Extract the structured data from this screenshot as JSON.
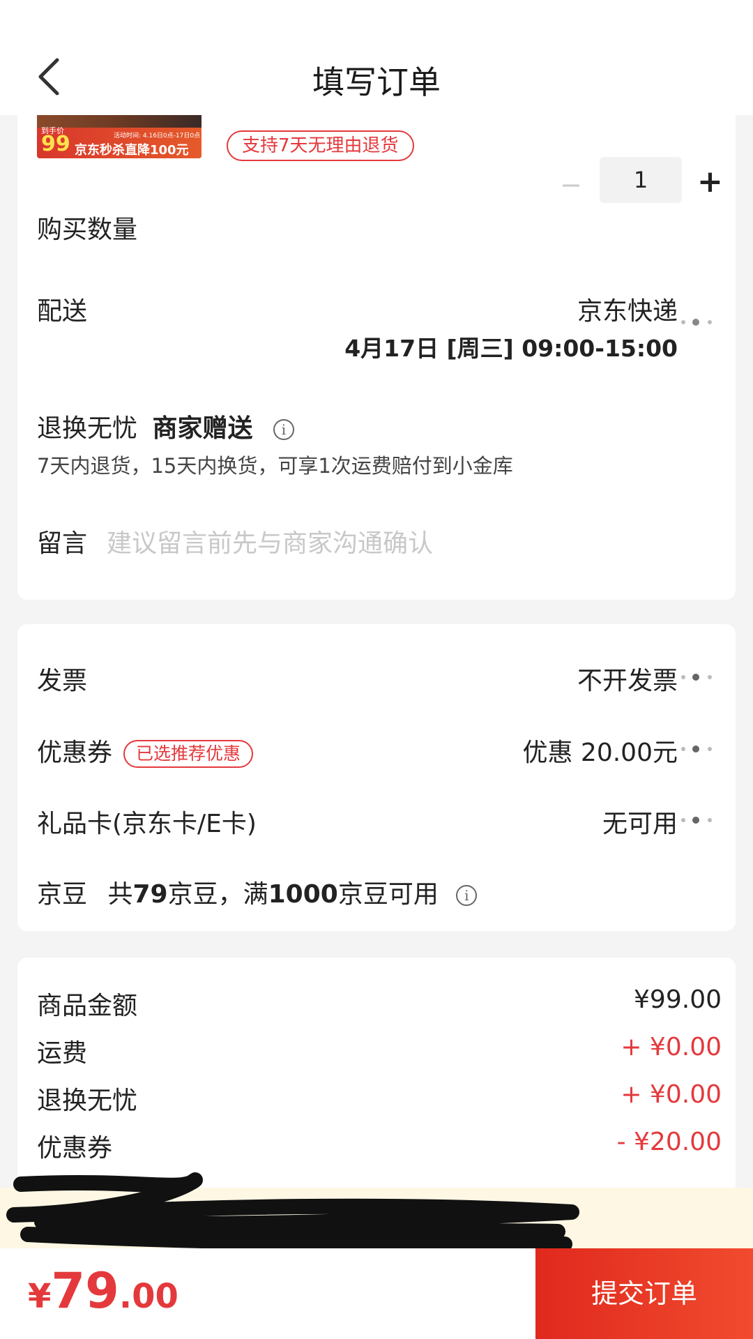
{
  "header": {
    "title": "填写订单"
  },
  "product": {
    "thumb_price": "99",
    "thumb_price_label": "到手价",
    "thumb_activity": "活动时间: 4.16日0点-17日0点",
    "thumb_promo": "京东秒杀直降100元",
    "return_badge": "支持7天无理由退货"
  },
  "quantity": {
    "label": "购买数量",
    "value": "1",
    "minus": "−",
    "plus": "+"
  },
  "delivery": {
    "label": "配送",
    "carrier": "京东快递",
    "time": "4月17日 [周三] 09:00-15:00"
  },
  "guarantee": {
    "label": "退换无忧",
    "strong": "商家赠送",
    "info": "i",
    "desc": "7天内退货，15天内换货，可享1次运费赔付到小金库"
  },
  "message": {
    "label": "留言",
    "placeholder": "建议留言前先与商家沟通确认"
  },
  "invoice": {
    "label": "发票",
    "value": "不开发票"
  },
  "coupon": {
    "label": "优惠券",
    "tag": "已选推荐优惠",
    "value": "优惠 20.00元"
  },
  "giftcard": {
    "label": "礼品卡(京东卡/E卡)",
    "value": "无可用"
  },
  "jingdou": {
    "label": "京豆",
    "text_1": "共",
    "count": "79",
    "text_2": "京豆，满",
    "threshold": "1000",
    "text_3": "京豆可用",
    "info": "i"
  },
  "summary": {
    "rows": [
      {
        "label": "商品金额",
        "value": "¥99.00"
      },
      {
        "label": "运费",
        "value": "+ ¥0.00"
      },
      {
        "label": "退换无忧",
        "value": "+ ¥0.00"
      },
      {
        "label": "优惠券",
        "value": "- ¥20.00"
      }
    ]
  },
  "footer": {
    "currency": "¥",
    "total_int": "79",
    "total_dec": ".00",
    "submit": "提交订单"
  },
  "colors": {
    "accent": "#e4393c",
    "button": "#e8351f",
    "notice_bg": "#fdf7e4"
  }
}
